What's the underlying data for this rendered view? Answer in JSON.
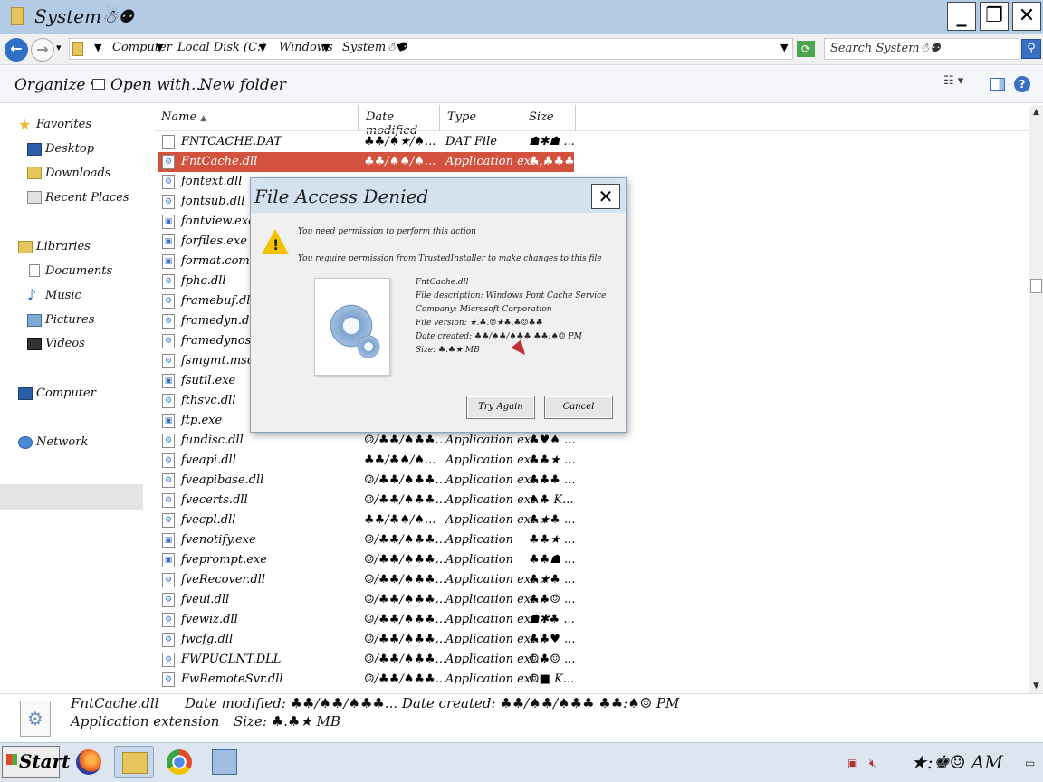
{
  "window": {
    "title": "System☃︎⚉︎"
  },
  "address": {
    "crumbs": [
      "Computer",
      "Local Disk (C:)",
      "Windows",
      "System☃︎⚉︎"
    ],
    "search_placeholder": "Search System☃︎⚉︎"
  },
  "toolbar": {
    "organize": "Organize ▾",
    "open_with": "Open with...",
    "new_folder": "New folder"
  },
  "nav": {
    "favorites": "Favorites",
    "desktop": "Desktop",
    "downloads": "Downloads",
    "recent": "Recent Places",
    "libraries": "Libraries",
    "documents": "Documents",
    "music": "Music",
    "pictures": "Pictures",
    "videos": "Videos",
    "computer": "Computer",
    "network": "Network"
  },
  "columns": {
    "name": "Name",
    "date": "Date modified",
    "type": "Type",
    "size": "Size"
  },
  "files": [
    {
      "name": "FNTCACHE.DAT",
      "date": "♣♣/♠★/♠...",
      "type": "DAT File",
      "size": "☗✱☗ ..."
    },
    {
      "name": "FntCache.dll",
      "date": "♣♣/♠♠/♠...",
      "type": "Application ext...",
      "size": "♣,♣♣♣ ..."
    },
    {
      "name": "fontext.dll",
      "date": "",
      "type": "",
      "size": ""
    },
    {
      "name": "fontsub.dll",
      "date": "",
      "type": "",
      "size": ""
    },
    {
      "name": "fontview.exe",
      "date": "",
      "type": "",
      "size": ""
    },
    {
      "name": "forfiles.exe",
      "date": "",
      "type": "",
      "size": ""
    },
    {
      "name": "format.com",
      "date": "",
      "type": "",
      "size": ""
    },
    {
      "name": "fphc.dll",
      "date": "",
      "type": "",
      "size": ""
    },
    {
      "name": "framebuf.dll",
      "date": "",
      "type": "",
      "size": ""
    },
    {
      "name": "framedyn.dll",
      "date": "",
      "type": "",
      "size": ""
    },
    {
      "name": "framedynos.dll",
      "date": "",
      "type": "",
      "size": ""
    },
    {
      "name": "fsmgmt.msc",
      "date": "",
      "type": "",
      "size": ""
    },
    {
      "name": "fsutil.exe",
      "date": "",
      "type": "",
      "size": ""
    },
    {
      "name": "fthsvc.dll",
      "date": "",
      "type": "",
      "size": ""
    },
    {
      "name": "ftp.exe",
      "date": "",
      "type": "",
      "size": ""
    },
    {
      "name": "fundisc.dll",
      "date": "☺/♣♣/♠♣♣...",
      "type": "Application ext...",
      "size": "♣♥♠ ..."
    },
    {
      "name": "fveapi.dll",
      "date": "♣♣/♣♠/♠...",
      "type": "Application ext...",
      "size": "♣♣★ ..."
    },
    {
      "name": "fveapibase.dll",
      "date": "☺/♣♣/♠♣♣...",
      "type": "Application ext...",
      "size": "♣♣♣ ..."
    },
    {
      "name": "fvecerts.dll",
      "date": "☺/♣♣/♠♣♣...",
      "type": "Application ext...",
      "size": "♠♣ K..."
    },
    {
      "name": "fvecpl.dll",
      "date": "♣♣/♣♠/♠...",
      "type": "Application ext...",
      "size": "♣★♣ ..."
    },
    {
      "name": "fvenotify.exe",
      "date": "☺/♣♣/♠♣♣...",
      "type": "Application",
      "size": "♣♣★ ..."
    },
    {
      "name": "fveprompt.exe",
      "date": "☺/♣♣/♠♣♣...",
      "type": "Application",
      "size": "♣♣☗ ..."
    },
    {
      "name": "fveRecover.dll",
      "date": "☺/♣♣/♠♣♣...",
      "type": "Application ext...",
      "size": "♣★♣ ..."
    },
    {
      "name": "fveui.dll",
      "date": "☺/♣♣/♠♣♣...",
      "type": "Application ext...",
      "size": "♣♣☺ ..."
    },
    {
      "name": "fvewiz.dll",
      "date": "☺/♣♣/♠♣♣...",
      "type": "Application ext...",
      "size": "☗✱♣ ..."
    },
    {
      "name": "fwcfg.dll",
      "date": "☺/♣♣/♠♣♣...",
      "type": "Application ext...",
      "size": "♣♣♥ ..."
    },
    {
      "name": "FWPUCLNT.DLL",
      "date": "☺/♣♣/♠♣♣...",
      "type": "Application ext...",
      "size": "☺♣☺ ..."
    },
    {
      "name": "FwRemoteSvr.dll",
      "date": "☺/♣♣/♠♣♣...",
      "type": "Application ext...",
      "size": "☺■ K..."
    }
  ],
  "details": {
    "name": "FntCache.dll",
    "type": "Application extension",
    "modified": "Date modified: ♣♣/♠♣/♠♣♣... Date created: ♣♣/♠♣/♠♣♣ ♣♣:♠☺ PM",
    "size": "Size: ♣.♣★ MB"
  },
  "taskbar": {
    "start": "Start",
    "clock": "★:♚☺ AM"
  },
  "dialog": {
    "title": "File Access Denied",
    "msg1": "You need permission to perform this action",
    "msg2": "You require permission from TrustedInstaller to make changes to this file",
    "file_name": "FntCache.dll",
    "file_desc": "File description: Windows Font Cache Service",
    "company": "Company: Microsoft Corporation",
    "version": "File version: ★.♣.☺★♣.♣☺♣♣",
    "created": "Date created: ♣♣/♠♣/♠♣♣ ♣♣:♠☺ PM",
    "size": "Size: ♣.♣★ MB",
    "try_again": "Try Again",
    "cancel": "Cancel"
  },
  "colors": {
    "selection": "#d2523d",
    "titlebar": "#b4cbe6",
    "dialog_title": "#d4e1ef"
  }
}
